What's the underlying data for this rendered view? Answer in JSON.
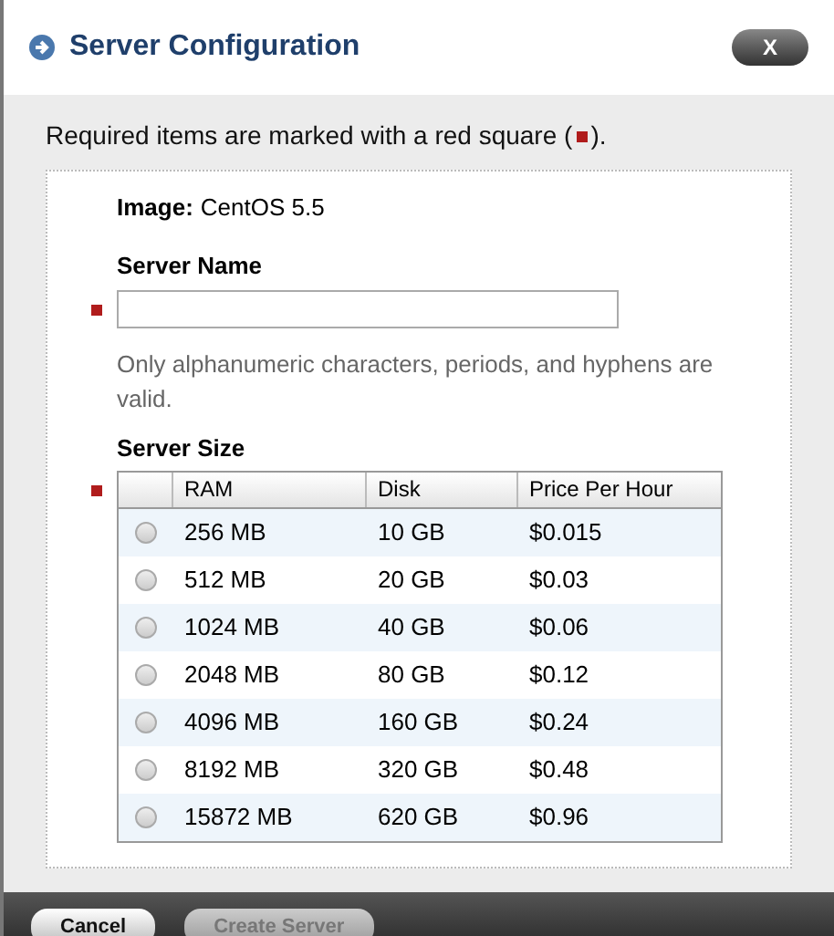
{
  "dialog": {
    "title": "Server Configuration",
    "close_label": "X"
  },
  "legend": {
    "before": "Required items are marked with a red square (",
    "after": ")."
  },
  "image": {
    "label": "Image:",
    "value": "CentOS 5.5"
  },
  "server_name": {
    "label": "Server Name",
    "required": true,
    "hint": "Only alphanumeric characters, periods, and hyphens are valid."
  },
  "server_size": {
    "label": "Server Size",
    "required": true,
    "columns": [
      "RAM",
      "Disk",
      "Price Per Hour"
    ],
    "rows": [
      {
        "ram": "256 MB",
        "disk": "10 GB",
        "price": "$0.015",
        "selected": false
      },
      {
        "ram": "512 MB",
        "disk": "20 GB",
        "price": "$0.03",
        "selected": false
      },
      {
        "ram": "1024 MB",
        "disk": "40 GB",
        "price": "$0.06",
        "selected": false
      },
      {
        "ram": "2048 MB",
        "disk": "80 GB",
        "price": "$0.12",
        "selected": false
      },
      {
        "ram": "4096 MB",
        "disk": "160 GB",
        "price": "$0.24",
        "selected": false
      },
      {
        "ram": "8192 MB",
        "disk": "320 GB",
        "price": "$0.48",
        "selected": false
      },
      {
        "ram": "15872 MB",
        "disk": "620 GB",
        "price": "$0.96",
        "selected": false
      }
    ]
  },
  "buttons": [
    {
      "label": "Cancel",
      "disabled": false
    },
    {
      "label": "Create Server",
      "disabled": true
    }
  ]
}
